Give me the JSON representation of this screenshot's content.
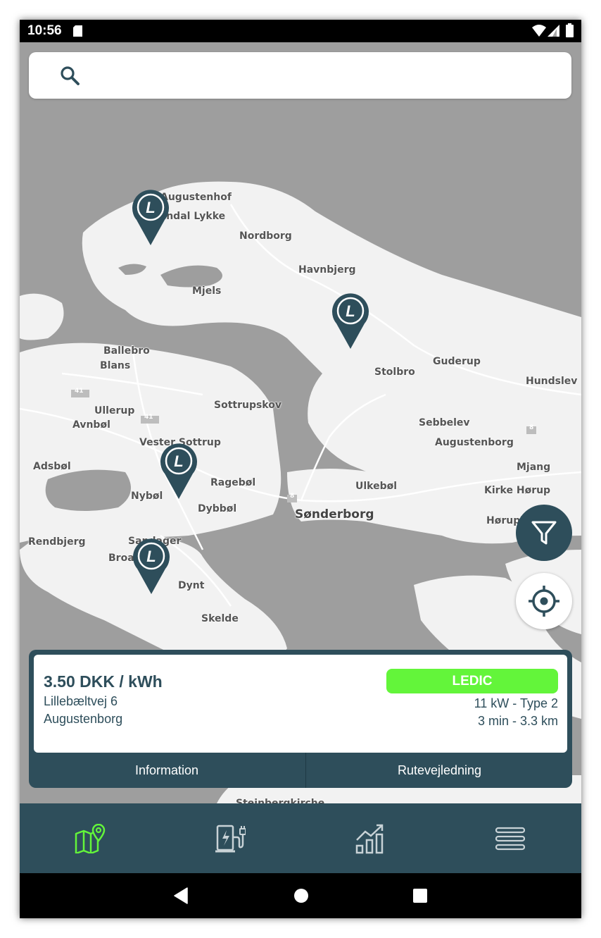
{
  "status_bar": {
    "time": "10:56"
  },
  "search": {
    "placeholder": "",
    "value": ""
  },
  "map": {
    "places": [
      {
        "name": "Augustenhof"
      },
      {
        "name": "Frydendal Lykke"
      },
      {
        "name": "Nordborg"
      },
      {
        "name": "Havnbjerg"
      },
      {
        "name": "Mjels"
      },
      {
        "name": "Ballebro"
      },
      {
        "name": "Blans"
      },
      {
        "name": "Stolbro"
      },
      {
        "name": "Guderup"
      },
      {
        "name": "Hundslev"
      },
      {
        "name": "Sottrupskov"
      },
      {
        "name": "Ullerup"
      },
      {
        "name": "Avnbøl"
      },
      {
        "name": "Sebbelev"
      },
      {
        "name": "Augustenborg"
      },
      {
        "name": "Vester Sottrup"
      },
      {
        "name": "Adsbøl"
      },
      {
        "name": "Mjang"
      },
      {
        "name": "Ragebøl"
      },
      {
        "name": "Ulkebøl"
      },
      {
        "name": "Nybøl"
      },
      {
        "name": "Kirke Hørup"
      },
      {
        "name": "Dybbøl"
      },
      {
        "name": "Sønderborg"
      },
      {
        "name": "Høruphav"
      },
      {
        "name": "Rendbjerg"
      },
      {
        "name": "Sandager"
      },
      {
        "name": "Broager"
      },
      {
        "name": "Dynt"
      },
      {
        "name": "Skelde"
      },
      {
        "name": "Steinbergkirche"
      }
    ],
    "road_shields": [
      "41",
      "41",
      "8",
      "8"
    ],
    "pin_letter": "L"
  },
  "station_card": {
    "price": "3.50 DKK / kWh",
    "address_line1": "Lillebæltvej 6",
    "address_line2": "Augustenborg",
    "operator_badge": "LEDIC",
    "connector": "11 kW - Type 2",
    "distance": "3 min - 3.3 km",
    "info_button": "Information",
    "route_button": "Rutevejledning"
  },
  "bottom_nav": {
    "items": [
      {
        "icon": "map-pin-icon",
        "active": true
      },
      {
        "icon": "charging-station-icon",
        "active": false
      },
      {
        "icon": "chart-icon",
        "active": false
      },
      {
        "icon": "menu-icon",
        "active": false
      }
    ]
  },
  "colors": {
    "primary": "#2e4e5b",
    "accent_green": "#63f53a",
    "land": "#f2f2f2",
    "water": "#9e9e9e"
  }
}
